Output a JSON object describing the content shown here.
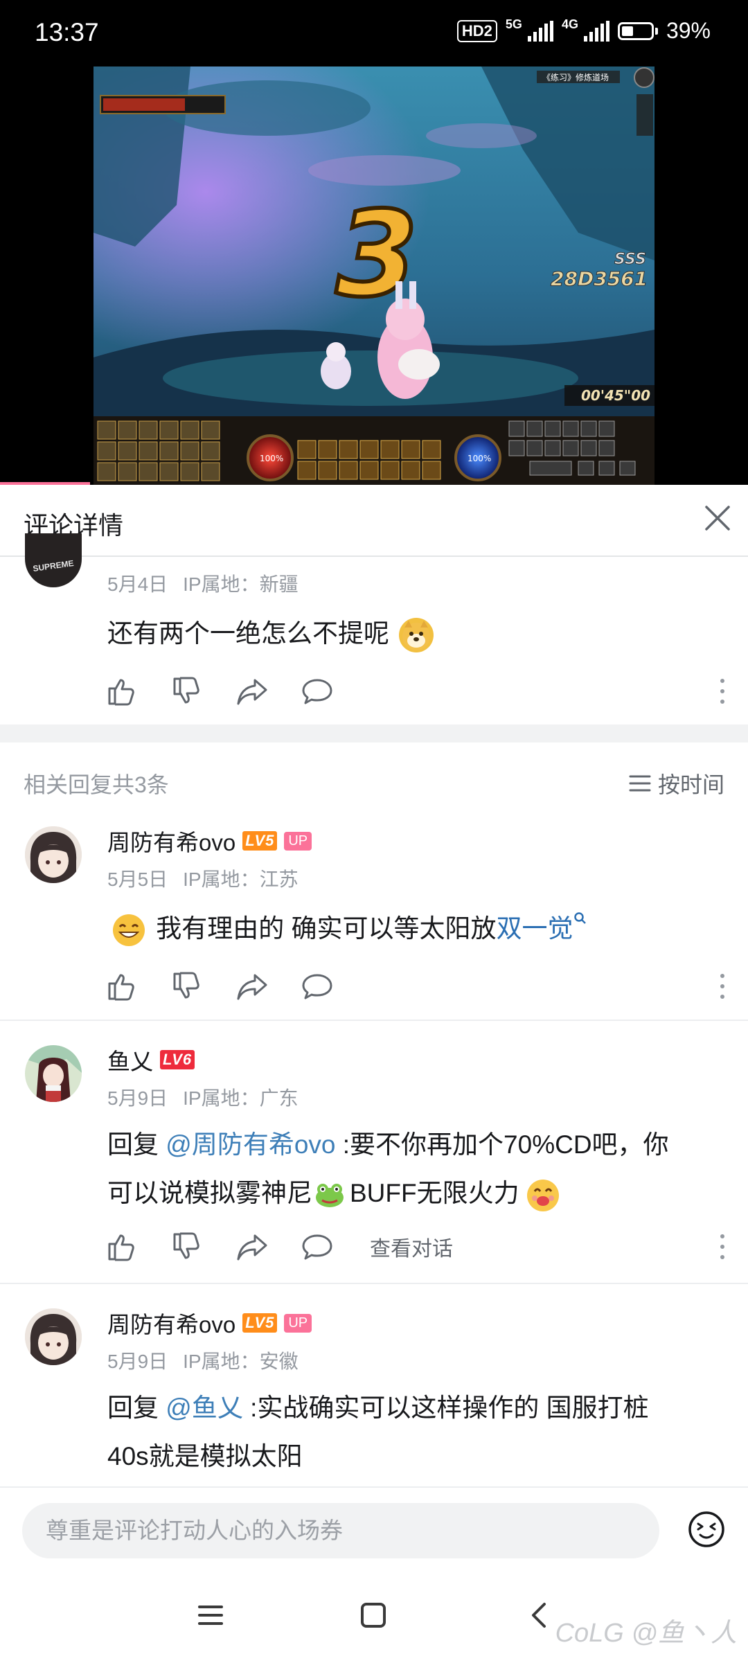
{
  "status_bar": {
    "time": "13:37",
    "hd": "HD2",
    "network1": "5G",
    "network2": "4G",
    "battery": "39%"
  },
  "video": {
    "hud_top_right": "《练习》修炼道场",
    "hud_side": "练习",
    "combo_number": "3",
    "rank": "SSS",
    "score": "28D3561",
    "timer": "00'45\"00",
    "hp_label": "100%",
    "mp_label": "100%"
  },
  "header": {
    "title": "评论详情"
  },
  "main_comment": {
    "date": "5月4日",
    "ip": "IP属地：新疆",
    "text": "还有两个一绝怎么不提呢",
    "avatar_text": "SUPREME"
  },
  "related": {
    "title": "相关回复共3条",
    "sort_label": "按时间"
  },
  "replies": [
    {
      "username": "周防有希ovo",
      "level": "LV5",
      "badge": "UP",
      "date": "5月5日",
      "ip": "IP属地：江苏",
      "text": "我有理由的 确实可以等太阳放",
      "link": "双一觉"
    },
    {
      "username": "鱼乂",
      "level": "LV6",
      "date": "5月9日",
      "ip": "IP属地：广东",
      "prefix": "回复 ",
      "mention": "@周防有希ovo",
      "text_line1": " :要不你再加个70%CD吧，你",
      "text_line2a": "可以说模拟雾神尼",
      "text_line2b": "BUFF无限火力",
      "view_conversation": "查看对话"
    },
    {
      "username": "周防有希ovo",
      "level": "LV5",
      "badge": "UP",
      "date": "5月9日",
      "ip": "IP属地：安徽",
      "prefix": "回复 ",
      "mention": "@鱼乂",
      "text_line1": " :实战确实可以这样操作的 国服打桩",
      "text_line2": "40s就是模拟太阳"
    }
  ],
  "input": {
    "placeholder": "尊重是评论打动人心的入场券"
  },
  "watermark": "CoLG @鱼丶人",
  "colors": {
    "accent_pink": "#fb7299",
    "link_blue": "#2b6fb3",
    "lv5": "#ff8d1a",
    "lv6": "#ee2b3c"
  }
}
